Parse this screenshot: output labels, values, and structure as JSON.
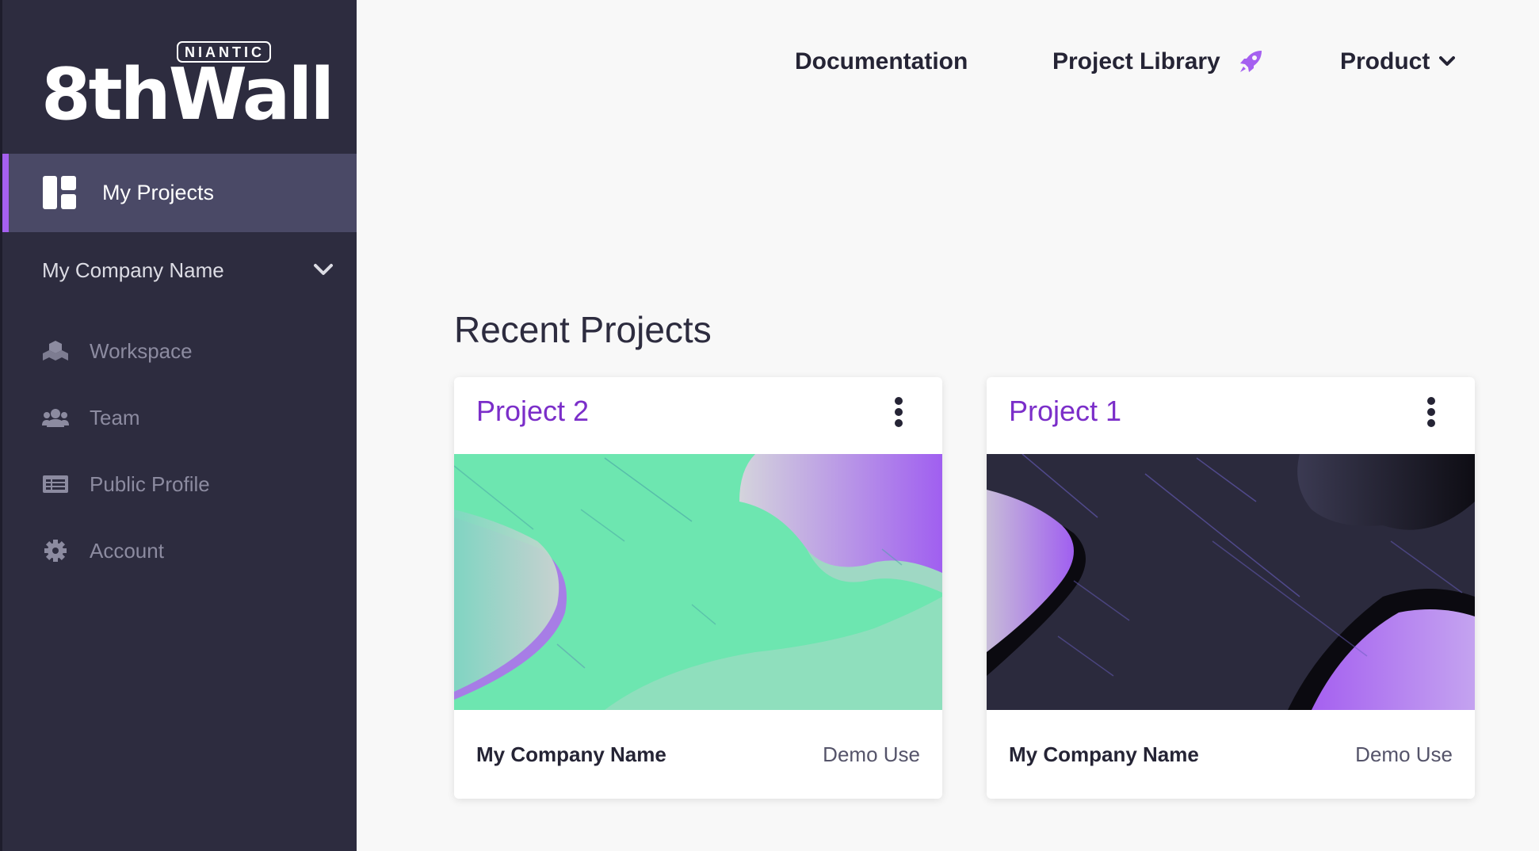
{
  "brand": {
    "badge": "NIANTIC",
    "wordmark": "8thWall"
  },
  "sidebar": {
    "active_item": {
      "label": "My Projects",
      "icon": "dashboard-grid-icon"
    },
    "company": {
      "label": "My Company Name",
      "icon": "chevron-down-icon"
    },
    "items": [
      {
        "label": "Workspace",
        "icon": "cubes-icon"
      },
      {
        "label": "Team",
        "icon": "users-icon"
      },
      {
        "label": "Public Profile",
        "icon": "id-card-icon"
      },
      {
        "label": "Account",
        "icon": "gear-icon"
      }
    ]
  },
  "topnav": {
    "documentation": "Documentation",
    "project_library": "Project Library",
    "project_library_icon": "rocket-icon",
    "product": "Product",
    "product_icon": "chevron-down-icon"
  },
  "main": {
    "section_title": "Recent Projects",
    "projects": [
      {
        "title": "Project 2",
        "owner": "My Company Name",
        "usage": "Demo Use",
        "theme": "green"
      },
      {
        "title": "Project 1",
        "owner": "My Company Name",
        "usage": "Demo Use",
        "theme": "dark"
      }
    ]
  },
  "colors": {
    "sidebar_bg": "#2d2c3f",
    "sidebar_active_bg": "#4a4966",
    "accent": "#a560f0",
    "project_title": "#7b2ec9",
    "page_bg": "#f8f8f8"
  }
}
